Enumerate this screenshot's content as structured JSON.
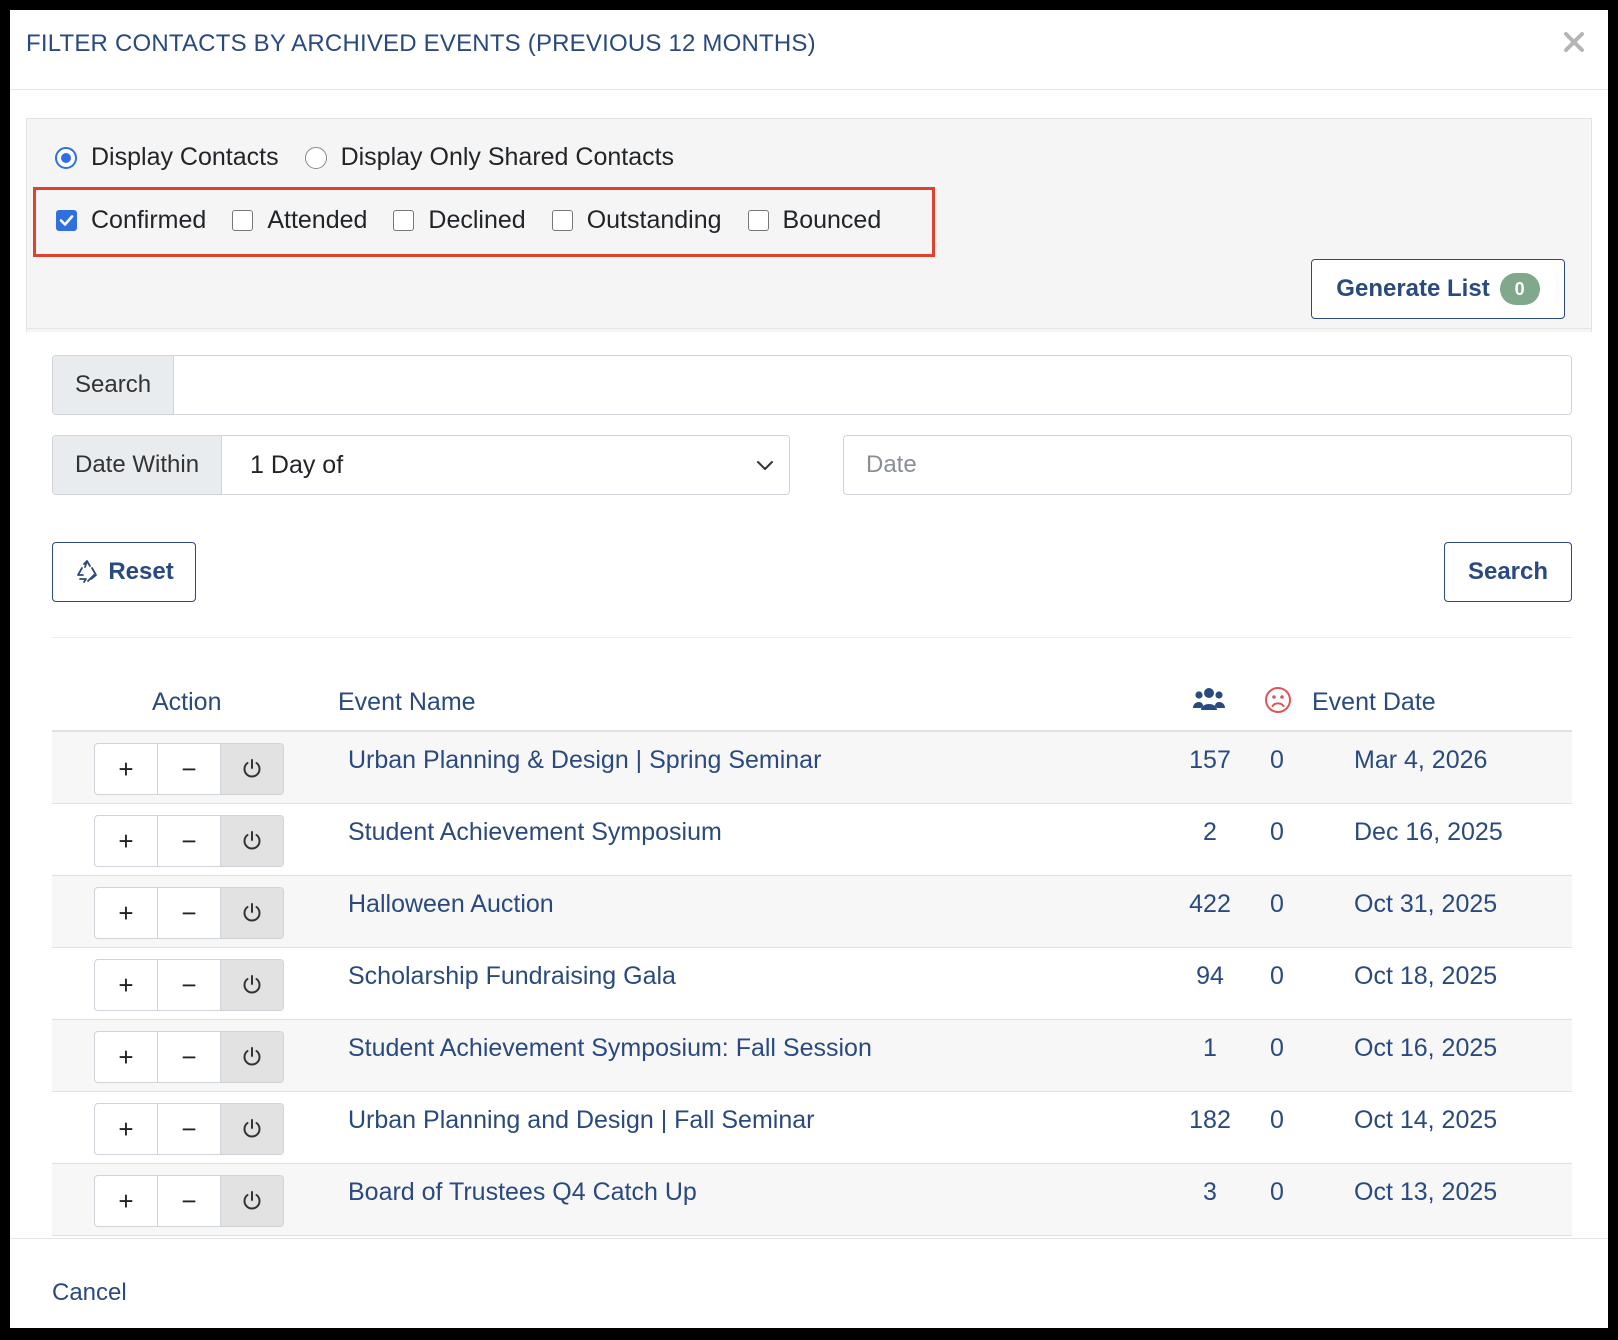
{
  "modal": {
    "title": "FILTER CONTACTS BY ARCHIVED EVENTS (PREVIOUS 12 MONTHS)",
    "close_icon": "close-icon"
  },
  "display_mode": {
    "options": [
      {
        "label": "Display Contacts",
        "selected": true
      },
      {
        "label": "Display Only Shared Contacts",
        "selected": false
      }
    ]
  },
  "statuses": [
    {
      "label": "Confirmed",
      "checked": true
    },
    {
      "label": "Attended",
      "checked": false
    },
    {
      "label": "Declined",
      "checked": false
    },
    {
      "label": "Outstanding",
      "checked": false
    },
    {
      "label": "Bounced",
      "checked": false
    }
  ],
  "generate": {
    "label": "Generate List",
    "count": "0"
  },
  "search": {
    "label": "Search",
    "value": ""
  },
  "date_within": {
    "label": "Date Within",
    "selected": "1 Day of",
    "placeholder": "Date"
  },
  "buttons": {
    "reset": "Reset",
    "search": "Search"
  },
  "table": {
    "headers": {
      "action": "Action",
      "event_name": "Event Name",
      "attendees_icon": "users-icon",
      "bounced_icon": "frown-icon",
      "event_date": "Event Date"
    },
    "rows": [
      {
        "name": "Urban Planning & Design | Spring Seminar",
        "count": "157",
        "bounced": "0",
        "date": "Mar 4, 2026"
      },
      {
        "name": "Student Achievement Symposium",
        "count": "2",
        "bounced": "0",
        "date": "Dec 16, 2025"
      },
      {
        "name": "Halloween Auction",
        "count": "422",
        "bounced": "0",
        "date": "Oct 31, 2025"
      },
      {
        "name": "Scholarship Fundraising Gala",
        "count": "94",
        "bounced": "0",
        "date": "Oct 18, 2025"
      },
      {
        "name": "Student Achievement Symposium: Fall Session",
        "count": "1",
        "bounced": "0",
        "date": "Oct 16, 2025"
      },
      {
        "name": "Urban Planning and Design | Fall Seminar",
        "count": "182",
        "bounced": "0",
        "date": "Oct 14, 2025"
      },
      {
        "name": "Board of Trustees Q4 Catch Up",
        "count": "3",
        "bounced": "0",
        "date": "Oct 13, 2025"
      }
    ]
  },
  "footer": {
    "cancel": "Cancel"
  },
  "colors": {
    "primary": "#2a4a7f",
    "highlight": "#e0412f",
    "radio_active": "#2f6fe0",
    "badge": "#7fa98a",
    "frown": "#e05555"
  }
}
